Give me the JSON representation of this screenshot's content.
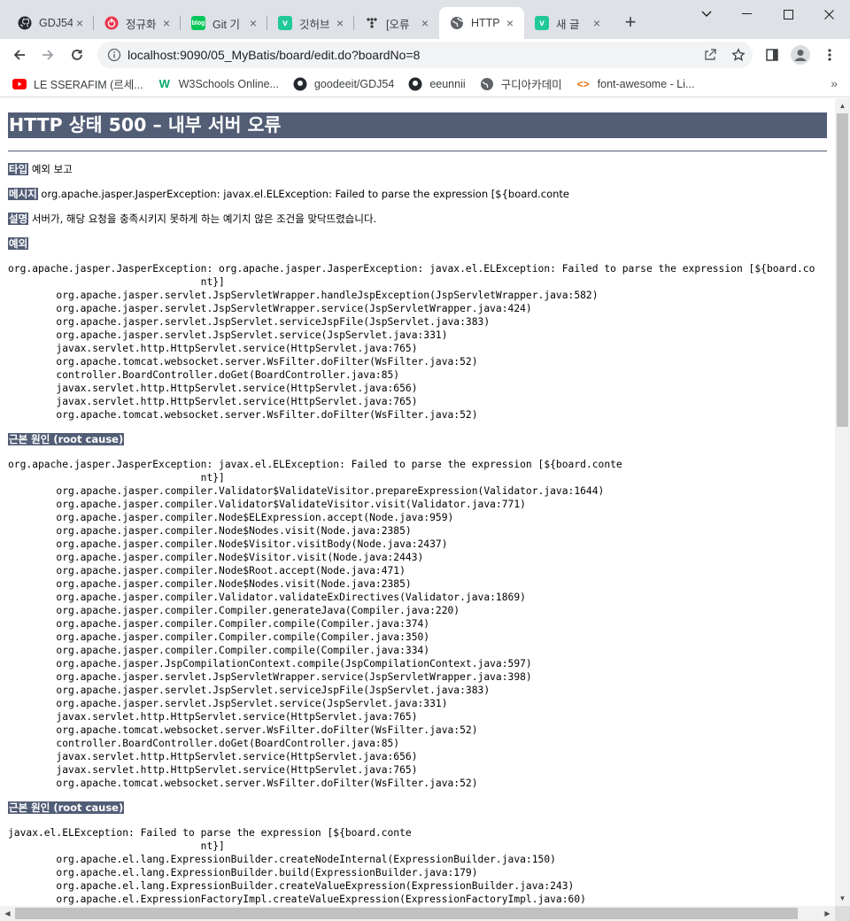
{
  "browser": {
    "tabs": [
      {
        "title": "GDJ54",
        "icon": "github-icon"
      },
      {
        "title": "정규화",
        "icon": "power-icon"
      },
      {
        "title": "Git 기",
        "icon": "blog-icon"
      },
      {
        "title": "깃허브",
        "icon": "velog-icon"
      },
      {
        "title": "[오류",
        "icon": "tistory-icon"
      },
      {
        "title": "HTTP",
        "icon": "globe-icon",
        "active": true
      },
      {
        "title": "새 글",
        "icon": "velog-icon"
      }
    ],
    "new_tab_label": "+",
    "url": "localhost:9090/05_MyBatis/board/edit.do?boardNo=8",
    "bookmarks": [
      {
        "label": "LE SSERAFIM (르세...",
        "icon": "youtube-icon"
      },
      {
        "label": "W3Schools Online...",
        "icon": "w3schools-icon"
      },
      {
        "label": "goodeeit/GDJ54",
        "icon": "github-icon"
      },
      {
        "label": "eeunnii",
        "icon": "github-icon"
      },
      {
        "label": "구디아카데미",
        "icon": "globe-icon"
      },
      {
        "label": "font-awesome - Li...",
        "icon": "code-icon"
      }
    ],
    "bookmarks_more": "»"
  },
  "page": {
    "title": "HTTP 상태 500 – 내부 서버 오류",
    "type_label": "타입",
    "type_value": "예외 보고",
    "message_label": "메시지",
    "message_value": "org.apache.jasper.JasperException: javax.el.ELException: Failed to parse the expression [${board.conte",
    "description_label": "설명",
    "description_value": "서버가, 해당 요청을 충족시키지 못하게 하는 예기치 않은 조건을 맞닥뜨렸습니다.",
    "exception_label": "예외",
    "exception_trace": "org.apache.jasper.JasperException: org.apache.jasper.JasperException: javax.el.ELException: Failed to parse the expression [${board.co\n                                nt}]\n\torg.apache.jasper.servlet.JspServletWrapper.handleJspException(JspServletWrapper.java:582)\n\torg.apache.jasper.servlet.JspServletWrapper.service(JspServletWrapper.java:424)\n\torg.apache.jasper.servlet.JspServlet.serviceJspFile(JspServlet.java:383)\n\torg.apache.jasper.servlet.JspServlet.service(JspServlet.java:331)\n\tjavax.servlet.http.HttpServlet.service(HttpServlet.java:765)\n\torg.apache.tomcat.websocket.server.WsFilter.doFilter(WsFilter.java:52)\n\tcontroller.BoardController.doGet(BoardController.java:85)\n\tjavax.servlet.http.HttpServlet.service(HttpServlet.java:656)\n\tjavax.servlet.http.HttpServlet.service(HttpServlet.java:765)\n\torg.apache.tomcat.websocket.server.WsFilter.doFilter(WsFilter.java:52)",
    "root_cause_label": "근본 원인 (root cause)",
    "root_cause_trace_1": "org.apache.jasper.JasperException: javax.el.ELException: Failed to parse the expression [${board.conte\n                                nt}]\n\torg.apache.jasper.compiler.Validator$ValidateVisitor.prepareExpression(Validator.java:1644)\n\torg.apache.jasper.compiler.Validator$ValidateVisitor.visit(Validator.java:771)\n\torg.apache.jasper.compiler.Node$ELExpression.accept(Node.java:959)\n\torg.apache.jasper.compiler.Node$Nodes.visit(Node.java:2385)\n\torg.apache.jasper.compiler.Node$Visitor.visitBody(Node.java:2437)\n\torg.apache.jasper.compiler.Node$Visitor.visit(Node.java:2443)\n\torg.apache.jasper.compiler.Node$Root.accept(Node.java:471)\n\torg.apache.jasper.compiler.Node$Nodes.visit(Node.java:2385)\n\torg.apache.jasper.compiler.Validator.validateExDirectives(Validator.java:1869)\n\torg.apache.jasper.compiler.Compiler.generateJava(Compiler.java:220)\n\torg.apache.jasper.compiler.Compiler.compile(Compiler.java:374)\n\torg.apache.jasper.compiler.Compiler.compile(Compiler.java:350)\n\torg.apache.jasper.compiler.Compiler.compile(Compiler.java:334)\n\torg.apache.jasper.JspCompilationContext.compile(JspCompilationContext.java:597)\n\torg.apache.jasper.servlet.JspServletWrapper.service(JspServletWrapper.java:398)\n\torg.apache.jasper.servlet.JspServlet.serviceJspFile(JspServlet.java:383)\n\torg.apache.jasper.servlet.JspServlet.service(JspServlet.java:331)\n\tjavax.servlet.http.HttpServlet.service(HttpServlet.java:765)\n\torg.apache.tomcat.websocket.server.WsFilter.doFilter(WsFilter.java:52)\n\tcontroller.BoardController.doGet(BoardController.java:85)\n\tjavax.servlet.http.HttpServlet.service(HttpServlet.java:656)\n\tjavax.servlet.http.HttpServlet.service(HttpServlet.java:765)\n\torg.apache.tomcat.websocket.server.WsFilter.doFilter(WsFilter.java:52)",
    "root_cause_trace_2": "javax.el.ELException: Failed to parse the expression [${board.conte\n                                nt}]\n\torg.apache.el.lang.ExpressionBuilder.createNodeInternal(ExpressionBuilder.java:150)\n\torg.apache.el.lang.ExpressionBuilder.build(ExpressionBuilder.java:179)\n\torg.apache.el.lang.ExpressionBuilder.createValueExpression(ExpressionBuilder.java:243)\n\torg.apache.el.ExpressionFactoryImpl.createValueExpression(ExpressionFactoryImpl.java:60)"
  },
  "colors": {
    "header_bg": "#525d76",
    "tabstrip_bg": "#dee1e6"
  }
}
